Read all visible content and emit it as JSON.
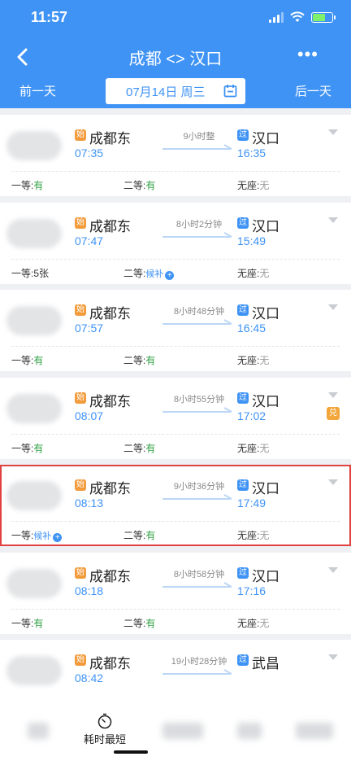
{
  "status_bar": {
    "time": "11:57"
  },
  "nav": {
    "title": "成都 <> 汉口",
    "more_label": "•••"
  },
  "date_row": {
    "prev_label": "前一天",
    "date": "07月14日 周三",
    "next_label": "后一天"
  },
  "trains": [
    {
      "from": "成都东",
      "from_badge": "始",
      "dep": "07:35",
      "duration": "9小时整",
      "to": "汉口",
      "to_badge": "过",
      "arr": "16:35",
      "seats": [
        {
          "label": "一等:",
          "value": "有",
          "kind": "yes"
        },
        {
          "label": "二等:",
          "value": "有",
          "kind": "yes"
        },
        {
          "label": "无座:",
          "value": "无",
          "kind": "none"
        }
      ]
    },
    {
      "from": "成都东",
      "from_badge": "始",
      "dep": "07:47",
      "duration": "8小时2分钟",
      "to": "汉口",
      "to_badge": "过",
      "arr": "15:49",
      "seats": [
        {
          "label": "一等:",
          "value": "5张",
          "kind": "count"
        },
        {
          "label": "二等:",
          "value": "候补",
          "kind": "wait"
        },
        {
          "label": "无座:",
          "value": "无",
          "kind": "none"
        }
      ]
    },
    {
      "from": "成都东",
      "from_badge": "始",
      "dep": "07:57",
      "duration": "8小时48分钟",
      "to": "汉口",
      "to_badge": "过",
      "arr": "16:45",
      "seats": [
        {
          "label": "一等:",
          "value": "有",
          "kind": "yes"
        },
        {
          "label": "二等:",
          "value": "有",
          "kind": "yes"
        },
        {
          "label": "无座:",
          "value": "无",
          "kind": "none"
        }
      ]
    },
    {
      "from": "成都东",
      "from_badge": "始",
      "dep": "08:07",
      "duration": "8小时55分钟",
      "to": "汉口",
      "to_badge": "过",
      "arr": "17:02",
      "extra_badge": "兑",
      "seats": [
        {
          "label": "一等:",
          "value": "有",
          "kind": "yes"
        },
        {
          "label": "二等:",
          "value": "有",
          "kind": "yes"
        },
        {
          "label": "无座:",
          "value": "无",
          "kind": "none"
        }
      ]
    },
    {
      "from": "成都东",
      "from_badge": "始",
      "dep": "08:13",
      "duration": "9小时36分钟",
      "to": "汉口",
      "to_badge": "过",
      "arr": "17:49",
      "selected": true,
      "seats": [
        {
          "label": "一等:",
          "value": "候补",
          "kind": "wait"
        },
        {
          "label": "二等:",
          "value": "有",
          "kind": "yes"
        },
        {
          "label": "无座:",
          "value": "无",
          "kind": "none"
        }
      ]
    },
    {
      "from": "成都东",
      "from_badge": "始",
      "dep": "08:18",
      "duration": "8小时58分钟",
      "to": "汉口",
      "to_badge": "过",
      "arr": "17:16",
      "seats": [
        {
          "label": "一等:",
          "value": "有",
          "kind": "yes"
        },
        {
          "label": "二等:",
          "value": "有",
          "kind": "yes"
        },
        {
          "label": "无座:",
          "value": "无",
          "kind": "none"
        }
      ]
    },
    {
      "from": "成都东",
      "from_badge": "始",
      "dep": "08:42",
      "duration": "19小时28分钟",
      "to": "武昌",
      "to_badge": "过",
      "arr": "",
      "seats": []
    }
  ],
  "bottom_bar": {
    "shortest_label": "耗时最短"
  },
  "colors": {
    "brand": "#3f93f5",
    "available": "#2ea043",
    "start_badge": "#f39a3a",
    "selected_outline": "#e14141"
  }
}
